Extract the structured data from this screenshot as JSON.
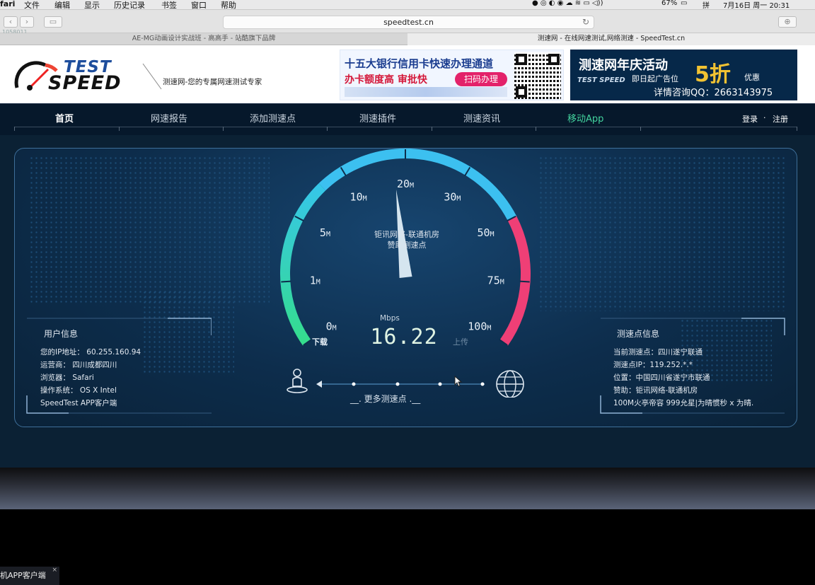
{
  "menubar": {
    "app": "fari",
    "items": [
      "文件",
      "编辑",
      "显示",
      "历史记录",
      "书签",
      "窗口",
      "帮助"
    ],
    "battery": "67%",
    "ime": "拼",
    "datetime": "7月16日 周一  20:31"
  },
  "browser": {
    "url": "speedtest.cn",
    "tabs": [
      "AE-MG动画设计实战班 - 高高手 - 站酷旗下品牌",
      "测速网 - 在线网速测试,网络测速 - SpeedTest.cn"
    ],
    "watermark": "1058011"
  },
  "header": {
    "logo_text": [
      "TEST",
      "SPEED"
    ],
    "slogan": "测速网-您的专属网速测试专家",
    "ad1": {
      "line1": "十五大银行信用卡快速办理通道",
      "line2": "办卡额度高 审批快",
      "button": "扫码办理"
    },
    "ad2": {
      "title": "测速网年庆活动",
      "line2": "即日起广告位",
      "discount": "5折",
      "discount_suffix": "优惠",
      "contact": "详情咨询QQ：2663143975",
      "logo": "TEST SPEED"
    }
  },
  "nav": {
    "items": [
      "首页",
      "网速报告",
      "添加测速点",
      "测速插件",
      "测速资讯",
      "移动App"
    ],
    "login": "登录",
    "dot": "·",
    "register": "注册"
  },
  "user_info": {
    "title": "用户信息",
    "lines": [
      "您的IP地址： 60.255.160.94",
      "运营商： 四川成都四川",
      "浏览器： Safari",
      "操作系统： OS X Intel",
      "SpeedTest APP客户端"
    ]
  },
  "server_info": {
    "title": "测速点信息",
    "lines": [
      "当前测速点：四川遂宁联通",
      "测速点IP：119.252.*.*",
      "位置：中国四川省遂宁市联通",
      "赞助：钜讯网络-联通机房",
      "100M火亭帝容 999允星|为晴惯秒 x 为晴."
    ]
  },
  "gauge": {
    "labels": [
      "0",
      "1",
      "5",
      "10",
      "20",
      "30",
      "50",
      "75",
      "100"
    ],
    "unit_suffix": "M",
    "needle_value": 18,
    "server_line1": "钜讯网络-联通机房",
    "server_line2": "赞助测速点",
    "unit": "Mbps",
    "speed": "16.22",
    "download": "下载",
    "upload": "上传",
    "more": "__. 更多测速点 .__"
  },
  "tooltip": "机APP客户端",
  "colors": {
    "green": "#33d69a",
    "blue": "#3cc0f0",
    "pink": "#ef3f76",
    "accent_nav": "#43d39e"
  }
}
